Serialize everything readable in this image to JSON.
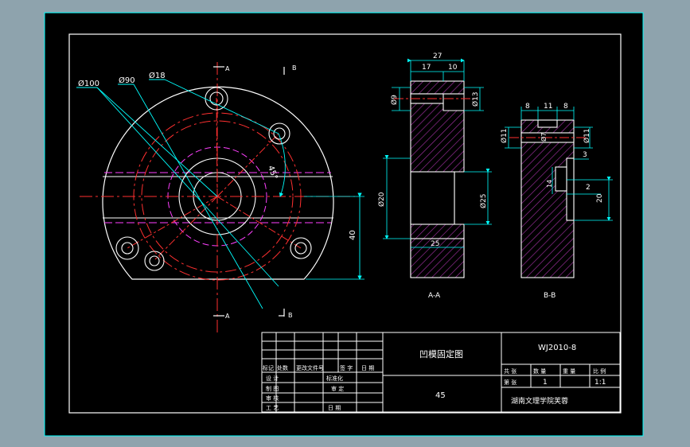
{
  "drawing": {
    "title": "凹模固定图",
    "code": "WJ2010-8",
    "material": "45",
    "organization": "湖南文理学院芙蓉",
    "section_aa": "A-A",
    "section_bb": "B-B",
    "marker_a": "A",
    "marker_b": "B"
  },
  "dimensions": {
    "d100": "Ø100",
    "d90": "Ø90",
    "d18": "Ø18",
    "ang45": "45°",
    "v40": "40",
    "w27": "27",
    "w17": "17",
    "w10": "10",
    "d9": "Ø9",
    "d13": "Ø13",
    "d20": "Ø20",
    "d25": "Ø25",
    "w25": "25",
    "b8a": "8",
    "b11": "11",
    "b8b": "8",
    "b_d11a": "Ø11",
    "b_d11b": "Ø11",
    "b_d7": "Ø7",
    "b3": "3",
    "b2": "2",
    "b20": "20",
    "b14": "14"
  },
  "title_block": {
    "h_mark": "标记",
    "h_count": "处数",
    "h_doc": "更改文件号",
    "h_sign": "签 字",
    "h_date": "日 期",
    "r_design": "设 计",
    "r_standard": "标准化",
    "r_draw": "制 图",
    "r_review": "审 定",
    "r_check": "审 核",
    "r_process": "工 艺",
    "r_date": "日 期",
    "p_total": "共 张",
    "p_qty": "数 量",
    "p_weight": "重 量",
    "p_scale": "比 例",
    "p_sheet": "第 张",
    "qty_val": "1",
    "scale_val": "1:1"
  },
  "colors": {
    "background": "#000000",
    "frame": "#00ffff",
    "outline": "#ffffff",
    "center": "#ff3030",
    "magenta": "#ff40ff",
    "hatch": "#b030b0"
  }
}
